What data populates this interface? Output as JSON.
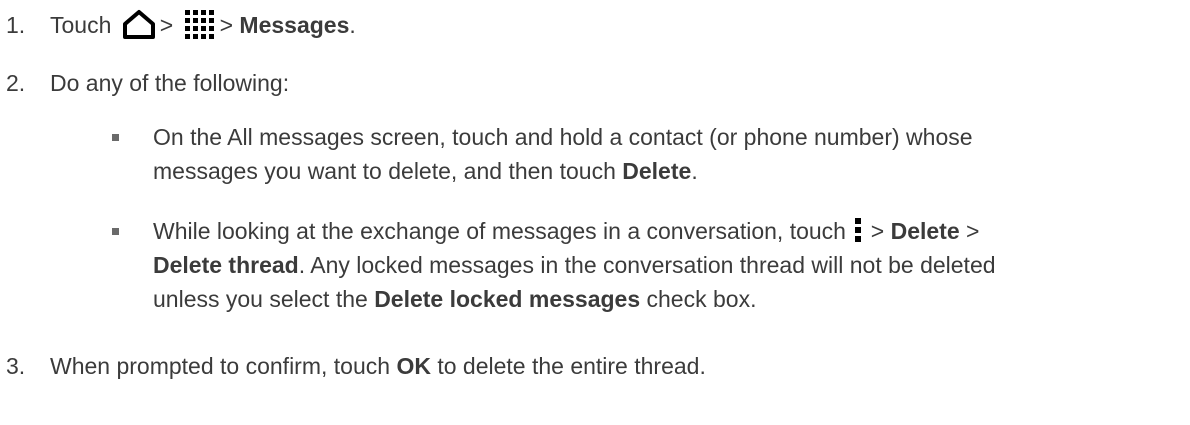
{
  "steps": [
    {
      "number": "1.",
      "parts": [
        "Touch",
        ">",
        ">",
        "Messages",
        "."
      ],
      "icons": [
        "home-icon",
        "apps-grid-icon"
      ]
    },
    {
      "number": "2.",
      "text": "Do any of the following:",
      "bullets": [
        {
          "line1": "On the All messages screen, touch and hold a contact (or phone number) whose",
          "line2_pre": "messages you want to delete, and then touch ",
          "line2_bold": "Delete",
          "line2_post": "."
        },
        {
          "line1_pre": "While looking at the exchange of messages in a conversation, touch",
          "line1_mid": " > ",
          "line1_bold": "Delete",
          "line1_post": " >",
          "icon": "overflow-menu-icon",
          "line2_bold": "Delete thread",
          "line2_post": ". Any locked messages in the conversation thread will not be deleted",
          "line3_pre": "unless you select the ",
          "line3_bold": "Delete locked messages",
          "line3_post": " check box."
        }
      ]
    },
    {
      "number": "3.",
      "pre": "When prompted to confirm, touch ",
      "bold": "OK",
      "post": " to delete the entire thread."
    }
  ],
  "colors": {
    "text": "#3b3b3b",
    "icon": "#000000"
  }
}
